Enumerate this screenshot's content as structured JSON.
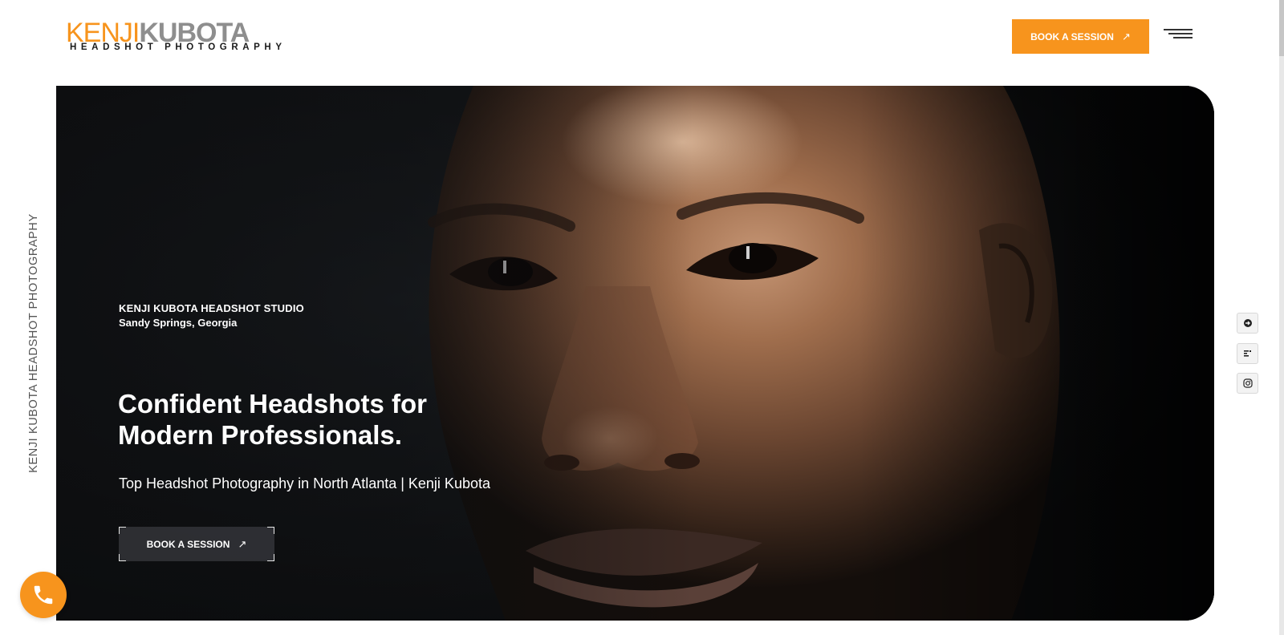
{
  "header": {
    "logo_first": "KENJI",
    "logo_last": "KUBOTA",
    "logo_sub": "HEADSHOT PHOTOGRAPHY",
    "book_label": "BOOK A SESSION",
    "menu_icon": "hamburger-menu-icon"
  },
  "side_caption": "KENJI KUBOTA HEADSHOT PHOTOGRAPHY",
  "hero": {
    "studio_name": "KENJI KUBOTA HEADSHOT STUDIO",
    "studio_location": "Sandy Springs, Georgia",
    "title_line1": "Confident Headshots for",
    "title_line2": "Modern Professionals.",
    "subtitle": "Top Headshot Photography in North Atlanta | Kenji Kubota",
    "book_label": "BOOK A SESSION",
    "image": "close-up portrait photograph of a man's face"
  },
  "social": [
    {
      "icon": "yelp-icon"
    },
    {
      "icon": "google-business-icon"
    },
    {
      "icon": "instagram-icon"
    }
  ],
  "call_button_icon": "phone-icon",
  "colors": {
    "accent": "#f7941d",
    "logo_gray": "#8e8e8e",
    "hero_dark": "#0c0d0f",
    "hero_button": "#34363a"
  }
}
